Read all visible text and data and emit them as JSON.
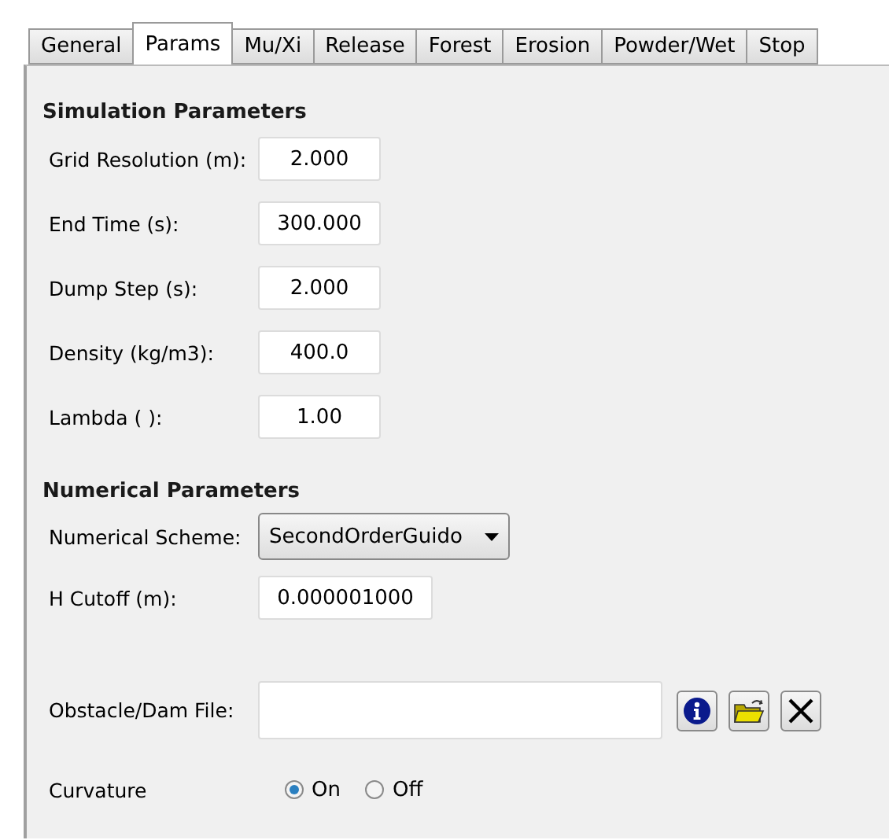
{
  "tabs": [
    {
      "label": "General",
      "selected": false
    },
    {
      "label": "Params",
      "selected": true
    },
    {
      "label": "Mu/Xi",
      "selected": false
    },
    {
      "label": "Release",
      "selected": false
    },
    {
      "label": "Forest",
      "selected": false
    },
    {
      "label": "Erosion",
      "selected": false
    },
    {
      "label": "Powder/Wet",
      "selected": false
    },
    {
      "label": "Stop",
      "selected": false
    }
  ],
  "simulation": {
    "title": "Simulation Parameters",
    "fields": [
      {
        "label": "Grid Resolution (m):",
        "value": "2.000"
      },
      {
        "label": "End Time (s):",
        "value": "300.000"
      },
      {
        "label": "Dump Step (s):",
        "value": "2.000"
      },
      {
        "label": "Density (kg/m3):",
        "value": "400.0"
      },
      {
        "label": "Lambda ( ):",
        "value": "1.00"
      }
    ]
  },
  "numerical": {
    "title": "Numerical Parameters",
    "scheme": {
      "label": "Numerical Scheme:",
      "value": "SecondOrderGuido"
    },
    "cutoff": {
      "label": "H Cutoff (m):",
      "value": "0.000001000"
    }
  },
  "obstacle": {
    "label": "Obstacle/Dam File:"
  },
  "curvature": {
    "label": "Curvature",
    "options": [
      {
        "label": "On",
        "selected": true
      },
      {
        "label": "Off",
        "selected": false
      }
    ]
  }
}
